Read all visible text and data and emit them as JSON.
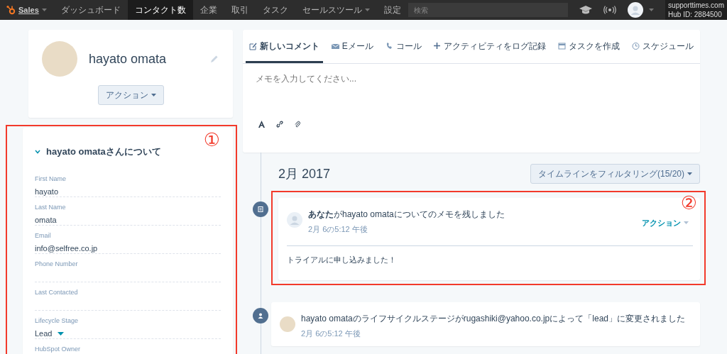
{
  "nav": {
    "brand": "Sales",
    "items": [
      {
        "label": "ダッシュボード",
        "selected": false,
        "dropdown": false
      },
      {
        "label": "コンタクト数",
        "selected": true,
        "dropdown": false
      },
      {
        "label": "企業",
        "selected": false,
        "dropdown": false
      },
      {
        "label": "取引",
        "selected": false,
        "dropdown": false
      },
      {
        "label": "タスク",
        "selected": false,
        "dropdown": false
      },
      {
        "label": "セールスツール",
        "selected": false,
        "dropdown": true
      },
      {
        "label": "設定",
        "selected": false,
        "dropdown": false
      }
    ],
    "search": {
      "placeholder": "検索"
    },
    "account": {
      "domain": "supporttimes.com",
      "hub_id": "Hub ID: 2884500"
    }
  },
  "profile": {
    "name": "hayato omata",
    "action_button": "アクション"
  },
  "about": {
    "title": "hayato omataさんについて",
    "expanded": true,
    "annotation": "①",
    "fields": [
      {
        "label": "First Name",
        "value": "hayato",
        "kind": "text"
      },
      {
        "label": "Last Name",
        "value": "omata",
        "kind": "text"
      },
      {
        "label": "Email",
        "value": "info@selfree.co.jp",
        "kind": "text"
      },
      {
        "label": "Phone Number"
      },
      {
        "label": "Last Contacted"
      },
      {
        "label": "Lifecycle Stage",
        "value": "Lead",
        "kind": "dropdown"
      },
      {
        "label": "HubSpot Owner"
      }
    ]
  },
  "composer": {
    "tabs": [
      {
        "label": "新しいコメント",
        "selected": true
      },
      {
        "label": "Eメール",
        "selected": false
      },
      {
        "label": "コール",
        "selected": false
      },
      {
        "label": "アクティビティをログ記録",
        "selected": false
      },
      {
        "label": "タスクを作成",
        "selected": false
      },
      {
        "label": "スケジュール",
        "selected": false
      }
    ],
    "placeholder": "メモを入力してください..."
  },
  "timeline": {
    "month": "2月 2017",
    "filter_button": "タイムラインをフィルタリング(15/20)",
    "events": [
      {
        "kind": "note",
        "title": "**あなた**がhayato omataについてのメモを残しました",
        "time": "2月 6の5:12 午後",
        "action": "アクション",
        "body": "トライアルに申し込みました！",
        "annotation": "②"
      },
      {
        "kind": "lifecycle",
        "title": "hayato omataのライフサイクルステージがrugashiki@yahoo.co.jpによって「lead」に変更されました",
        "time": "2月 6の5:12 午後"
      }
    ]
  }
}
